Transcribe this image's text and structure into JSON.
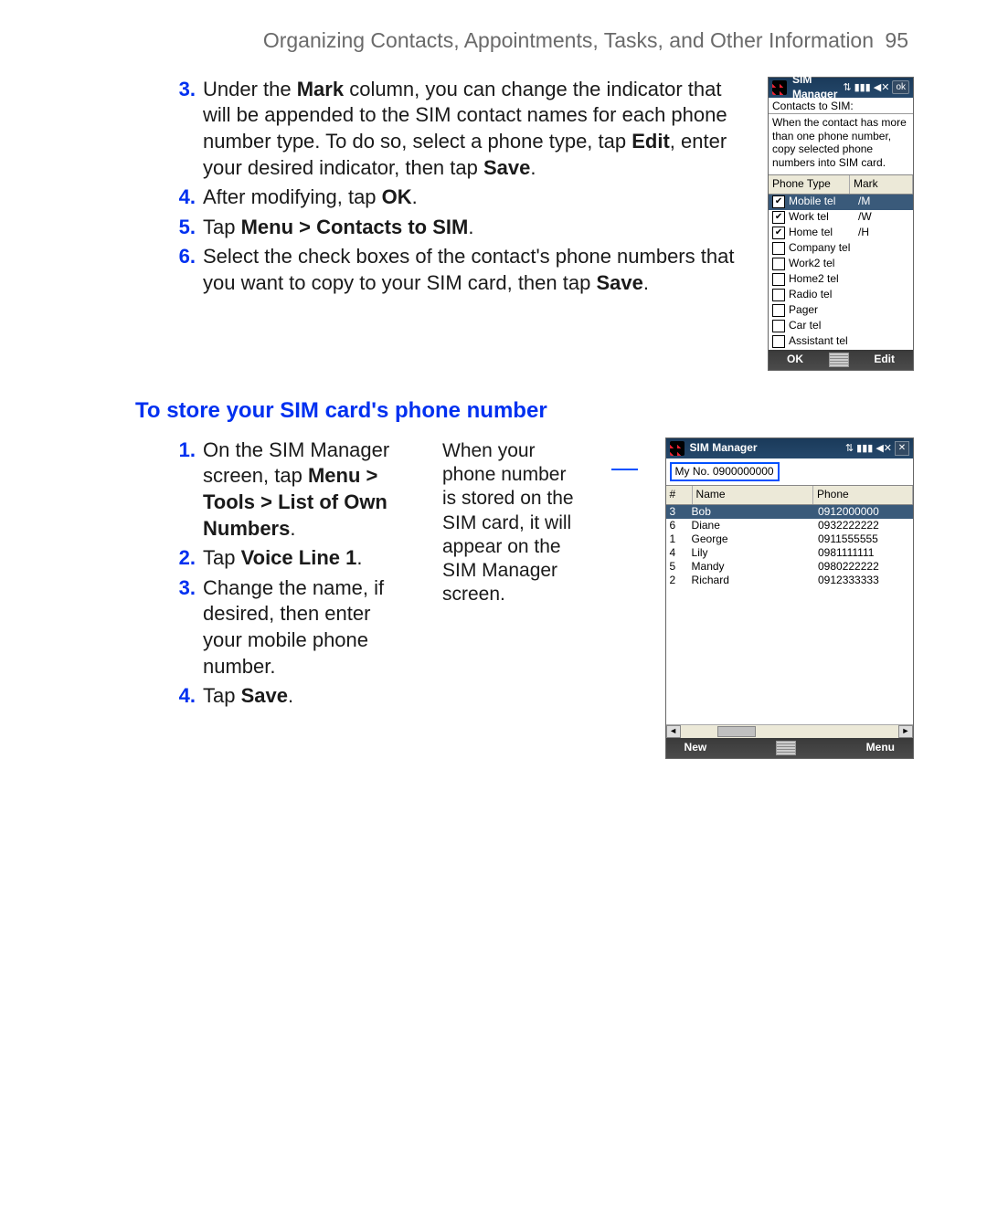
{
  "header": {
    "title": "Organizing Contacts, Appointments, Tasks, and Other Information",
    "page": "95"
  },
  "stepsA": {
    "3": {
      "num": "3.",
      "t1": "Under the ",
      "b1": "Mark",
      "t2": " column, you can change the indicator that will be appended to the SIM contact names for each phone number type. To do so, select a phone type, tap ",
      "b2": "Edit",
      "t3": ", enter your desired indicator, then tap ",
      "b3": "Save",
      "t4": "."
    },
    "4": {
      "num": "4.",
      "t1": "After modifying, tap ",
      "b1": "OK",
      "t2": "."
    },
    "5": {
      "num": "5.",
      "t1": "Tap ",
      "b1": "Menu > Contacts to SIM",
      "t2": "."
    },
    "6": {
      "num": "6.",
      "t1": "Select the check boxes of the contact's phone numbers that you want to copy to your SIM card, then tap ",
      "b1": "Save",
      "t2": "."
    }
  },
  "sectionHeading": "To store your SIM card's phone number",
  "stepsB": {
    "1": {
      "num": "1.",
      "t1": "On the SIM Manager screen, tap ",
      "b1": "Menu > Tools > List of Own Numbers",
      "t2": "."
    },
    "2": {
      "num": "2.",
      "t1": "Tap ",
      "b1": "Voice Line 1",
      "t2": "."
    },
    "3": {
      "num": "3.",
      "t1": "Change the name, if desired, then enter your mobile phone number."
    },
    "4": {
      "num": "4.",
      "t1": "Tap ",
      "b1": "Save",
      "t2": "."
    }
  },
  "sideNote": "When your phone number is stored on the SIM card, it will appear on the SIM Manager screen.",
  "fig1": {
    "title": "SIM Manager",
    "okBadge": "ok",
    "subheader": "Contacts to SIM:",
    "desc": "When the contact has more than one phone number, copy selected phone numbers into SIM card.",
    "colPhoneType": "Phone Type",
    "colMark": "Mark",
    "rows": [
      {
        "checked": true,
        "selected": true,
        "label": "Mobile tel",
        "mark": "/M"
      },
      {
        "checked": true,
        "selected": false,
        "label": "Work tel",
        "mark": "/W"
      },
      {
        "checked": true,
        "selected": false,
        "label": "Home tel",
        "mark": "/H"
      },
      {
        "checked": false,
        "selected": false,
        "label": "Company tel",
        "mark": ""
      },
      {
        "checked": false,
        "selected": false,
        "label": "Work2 tel",
        "mark": ""
      },
      {
        "checked": false,
        "selected": false,
        "label": "Home2 tel",
        "mark": ""
      },
      {
        "checked": false,
        "selected": false,
        "label": "Radio tel",
        "mark": ""
      },
      {
        "checked": false,
        "selected": false,
        "label": "Pager",
        "mark": ""
      },
      {
        "checked": false,
        "selected": false,
        "label": "Car tel",
        "mark": ""
      },
      {
        "checked": false,
        "selected": false,
        "label": "Assistant tel",
        "mark": ""
      }
    ],
    "softLeft": "OK",
    "softRight": "Edit"
  },
  "fig2": {
    "title": "SIM Manager",
    "myNo": "My No. 0900000000",
    "colIdx": "#",
    "colName": "Name",
    "colPhone": "Phone",
    "rows": [
      {
        "idx": "3",
        "name": "Bob",
        "phone": "0912000000",
        "selected": true
      },
      {
        "idx": "6",
        "name": "Diane",
        "phone": "0932222222",
        "selected": false
      },
      {
        "idx": "1",
        "name": "George",
        "phone": "0911555555",
        "selected": false
      },
      {
        "idx": "4",
        "name": "Lily",
        "phone": "0981111111",
        "selected": false
      },
      {
        "idx": "5",
        "name": "Mandy",
        "phone": "0980222222",
        "selected": false
      },
      {
        "idx": "2",
        "name": "Richard",
        "phone": "0912333333",
        "selected": false
      }
    ],
    "softLeft": "New",
    "softRight": "Menu"
  },
  "icons": {
    "sync": "⇅",
    "signal": "▮▮▮",
    "volume": "◀✕",
    "close": "✕",
    "left": "◄",
    "right": "►"
  }
}
